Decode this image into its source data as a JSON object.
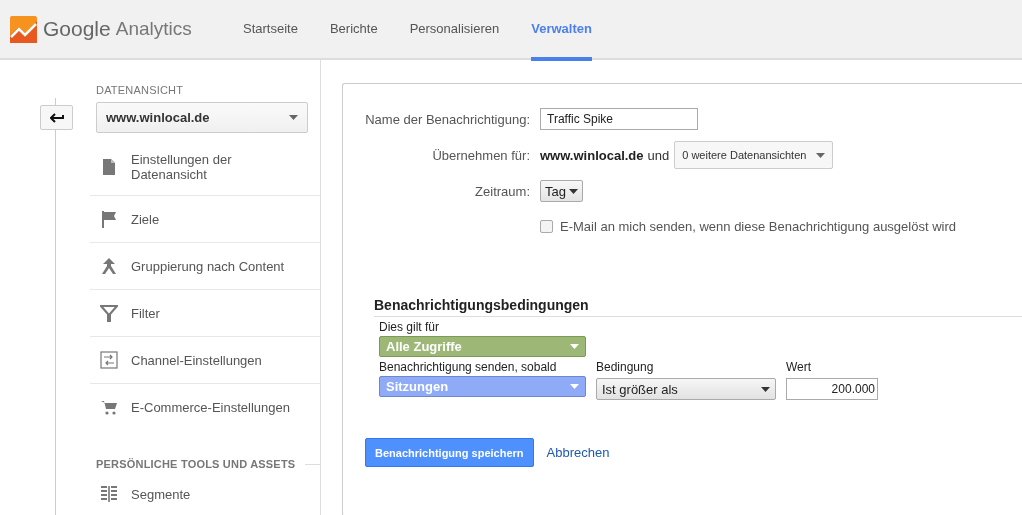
{
  "header": {
    "logo_brand": "Google",
    "logo_product": "Analytics",
    "tabs": [
      {
        "label": "Startseite",
        "selected": false
      },
      {
        "label": "Berichte",
        "selected": false
      },
      {
        "label": "Personalisieren",
        "selected": false
      },
      {
        "label": "Verwalten",
        "selected": true
      }
    ]
  },
  "sidebar": {
    "section_label": "DATENANSICHT",
    "view_select": "www.winlocal.de",
    "items": [
      {
        "label": "Einstellungen der Datenansicht",
        "kind": "document"
      },
      {
        "label": "Ziele",
        "kind": "flag"
      },
      {
        "label": "Gruppierung nach Content",
        "kind": "merge"
      },
      {
        "label": "Filter",
        "kind": "funnel"
      },
      {
        "label": "Channel-Einstellungen",
        "kind": "channel"
      },
      {
        "label": "E-Commerce-Einstellungen",
        "kind": "cart"
      }
    ],
    "section_2_label": "PERSÖNLICHE TOOLS UND ASSETS",
    "items_2": [
      {
        "label": "Segmente",
        "kind": "segments"
      }
    ]
  },
  "form": {
    "name_label": "Name der Benachrichtigung:",
    "name_value": "Traffic Spike",
    "apply_label": "Übernehmen für:",
    "apply_site": "www.winlocal.de",
    "apply_and": "und",
    "apply_select": "0 weitere Datenansichten",
    "period_label": "Zeitraum:",
    "period_select": "Tag",
    "email": {
      "label": "E-Mail an mich senden, wenn diese Benachrichtigung ausgelöst wird",
      "checked": false
    }
  },
  "conditions": {
    "title": "Benachrichtigungsbedingungen",
    "applies_label": "Dies gilt für",
    "applies_select": "Alle Zugriffe",
    "send_label": "Benachrichtigung senden, sobald",
    "send_select": "Sitzungen",
    "condition_label": "Bedingung",
    "condition_select": "Ist größer als",
    "value_label": "Wert",
    "value": "200.000"
  },
  "buttons": {
    "save": "Benachrichtigung speichern",
    "cancel": "Abbrechen"
  }
}
